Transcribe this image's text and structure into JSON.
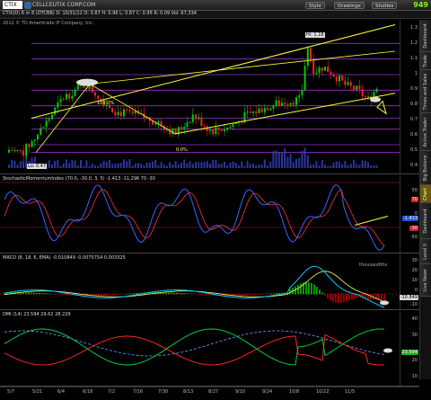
{
  "toolbar": {
    "symbol": "CTIX",
    "url": "CELLCEUTIX CORP.COM",
    "buttons": [
      "Style",
      "Drawings",
      "Studies"
    ],
    "price": "949"
  },
  "quote_line": "CTIX(D) 6 m 8 (OTCBB)  D: 10/31/12  O: 0.87  H: 0.96  L: 0.87  C: 0.95  R: 0.09  Vol: 67,334",
  "copyright": "2012 © TD Ameritrade IP Company, Inc.",
  "price_panel": {
    "yticks": [
      "1.3",
      "1.2",
      "1.1",
      "1",
      "0.9",
      "0.8",
      "0.7",
      "0.6",
      "0.5",
      "0.4"
    ],
    "hi_label": "Hi: 1.18",
    "lo_label": "Lo: 0.47",
    "pct1": "100.0%",
    "pct2": "0.0%"
  },
  "stoch_panel": {
    "label": "StochasticMomentumIndex (70.0, -30.0, 3, 5)  -1.413  -11.296  70  -30",
    "tags": [
      "70",
      "-1.413",
      "-30"
    ],
    "yticks": [
      "50",
      "0",
      "-50"
    ]
  },
  "macd_panel": {
    "label": "MACD (8, 18, 6, EMA)  -0.010849  -0.0075754  0.003325",
    "tags": [
      "-10.849"
    ],
    "yticks": [
      "30",
      "20",
      "10",
      "0",
      "-10"
    ],
    "axis_note": "thousandths"
  },
  "dmi_panel": {
    "label": "DMI (14)  23.594  29.62  28.229",
    "tags": [
      "23.594"
    ],
    "yticks": [
      "40",
      "30",
      "20",
      "10"
    ]
  },
  "xaxis": [
    "5/7",
    "5/21",
    "6/4",
    "6/18",
    "7/2",
    "7/16",
    "7/30",
    "8/13",
    "8/27",
    "9/10",
    "9/24",
    "10/8",
    "10/22",
    "11/5"
  ],
  "right_tabs": [
    "Dashboard",
    "Trade",
    "Times and Sales",
    "Active Trader",
    "Big Buttons",
    "Chart",
    "Dashboard",
    "Level II",
    "Live News"
  ],
  "colors": {
    "channel": "#ffff33",
    "fib_lines": "#9933cc",
    "up_candle": "#00cc00",
    "down_candle": "#ff2222",
    "volume": "#3344cc",
    "stoch": "#3366ff",
    "stoch_signal": "#ff3333",
    "macd": "#00ccff",
    "macd_signal": "#ffff66",
    "dmi_plus": "#00cc44",
    "dmi_minus": "#ff2222",
    "adx": "#66aaff"
  }
}
